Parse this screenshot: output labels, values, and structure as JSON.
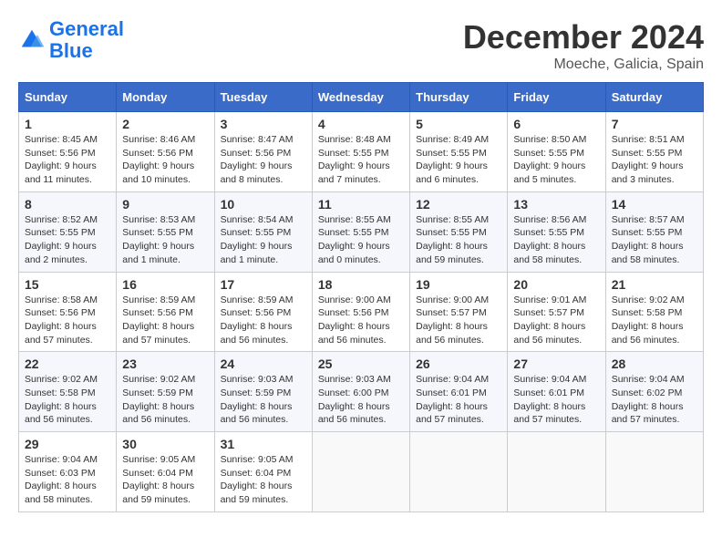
{
  "header": {
    "logo_line1": "General",
    "logo_line2": "Blue",
    "month_title": "December 2024",
    "location": "Moeche, Galicia, Spain"
  },
  "weekdays": [
    "Sunday",
    "Monday",
    "Tuesday",
    "Wednesday",
    "Thursday",
    "Friday",
    "Saturday"
  ],
  "weeks": [
    [
      {
        "day": "1",
        "info": "Sunrise: 8:45 AM\nSunset: 5:56 PM\nDaylight: 9 hours and 11 minutes."
      },
      {
        "day": "2",
        "info": "Sunrise: 8:46 AM\nSunset: 5:56 PM\nDaylight: 9 hours and 10 minutes."
      },
      {
        "day": "3",
        "info": "Sunrise: 8:47 AM\nSunset: 5:56 PM\nDaylight: 9 hours and 8 minutes."
      },
      {
        "day": "4",
        "info": "Sunrise: 8:48 AM\nSunset: 5:55 PM\nDaylight: 9 hours and 7 minutes."
      },
      {
        "day": "5",
        "info": "Sunrise: 8:49 AM\nSunset: 5:55 PM\nDaylight: 9 hours and 6 minutes."
      },
      {
        "day": "6",
        "info": "Sunrise: 8:50 AM\nSunset: 5:55 PM\nDaylight: 9 hours and 5 minutes."
      },
      {
        "day": "7",
        "info": "Sunrise: 8:51 AM\nSunset: 5:55 PM\nDaylight: 9 hours and 3 minutes."
      }
    ],
    [
      {
        "day": "8",
        "info": "Sunrise: 8:52 AM\nSunset: 5:55 PM\nDaylight: 9 hours and 2 minutes."
      },
      {
        "day": "9",
        "info": "Sunrise: 8:53 AM\nSunset: 5:55 PM\nDaylight: 9 hours and 1 minute."
      },
      {
        "day": "10",
        "info": "Sunrise: 8:54 AM\nSunset: 5:55 PM\nDaylight: 9 hours and 1 minute."
      },
      {
        "day": "11",
        "info": "Sunrise: 8:55 AM\nSunset: 5:55 PM\nDaylight: 9 hours and 0 minutes."
      },
      {
        "day": "12",
        "info": "Sunrise: 8:55 AM\nSunset: 5:55 PM\nDaylight: 8 hours and 59 minutes."
      },
      {
        "day": "13",
        "info": "Sunrise: 8:56 AM\nSunset: 5:55 PM\nDaylight: 8 hours and 58 minutes."
      },
      {
        "day": "14",
        "info": "Sunrise: 8:57 AM\nSunset: 5:55 PM\nDaylight: 8 hours and 58 minutes."
      }
    ],
    [
      {
        "day": "15",
        "info": "Sunrise: 8:58 AM\nSunset: 5:56 PM\nDaylight: 8 hours and 57 minutes."
      },
      {
        "day": "16",
        "info": "Sunrise: 8:59 AM\nSunset: 5:56 PM\nDaylight: 8 hours and 57 minutes."
      },
      {
        "day": "17",
        "info": "Sunrise: 8:59 AM\nSunset: 5:56 PM\nDaylight: 8 hours and 56 minutes."
      },
      {
        "day": "18",
        "info": "Sunrise: 9:00 AM\nSunset: 5:56 PM\nDaylight: 8 hours and 56 minutes."
      },
      {
        "day": "19",
        "info": "Sunrise: 9:00 AM\nSunset: 5:57 PM\nDaylight: 8 hours and 56 minutes."
      },
      {
        "day": "20",
        "info": "Sunrise: 9:01 AM\nSunset: 5:57 PM\nDaylight: 8 hours and 56 minutes."
      },
      {
        "day": "21",
        "info": "Sunrise: 9:02 AM\nSunset: 5:58 PM\nDaylight: 8 hours and 56 minutes."
      }
    ],
    [
      {
        "day": "22",
        "info": "Sunrise: 9:02 AM\nSunset: 5:58 PM\nDaylight: 8 hours and 56 minutes."
      },
      {
        "day": "23",
        "info": "Sunrise: 9:02 AM\nSunset: 5:59 PM\nDaylight: 8 hours and 56 minutes."
      },
      {
        "day": "24",
        "info": "Sunrise: 9:03 AM\nSunset: 5:59 PM\nDaylight: 8 hours and 56 minutes."
      },
      {
        "day": "25",
        "info": "Sunrise: 9:03 AM\nSunset: 6:00 PM\nDaylight: 8 hours and 56 minutes."
      },
      {
        "day": "26",
        "info": "Sunrise: 9:04 AM\nSunset: 6:01 PM\nDaylight: 8 hours and 57 minutes."
      },
      {
        "day": "27",
        "info": "Sunrise: 9:04 AM\nSunset: 6:01 PM\nDaylight: 8 hours and 57 minutes."
      },
      {
        "day": "28",
        "info": "Sunrise: 9:04 AM\nSunset: 6:02 PM\nDaylight: 8 hours and 57 minutes."
      }
    ],
    [
      {
        "day": "29",
        "info": "Sunrise: 9:04 AM\nSunset: 6:03 PM\nDaylight: 8 hours and 58 minutes."
      },
      {
        "day": "30",
        "info": "Sunrise: 9:05 AM\nSunset: 6:04 PM\nDaylight: 8 hours and 59 minutes."
      },
      {
        "day": "31",
        "info": "Sunrise: 9:05 AM\nSunset: 6:04 PM\nDaylight: 8 hours and 59 minutes."
      },
      null,
      null,
      null,
      null
    ]
  ]
}
